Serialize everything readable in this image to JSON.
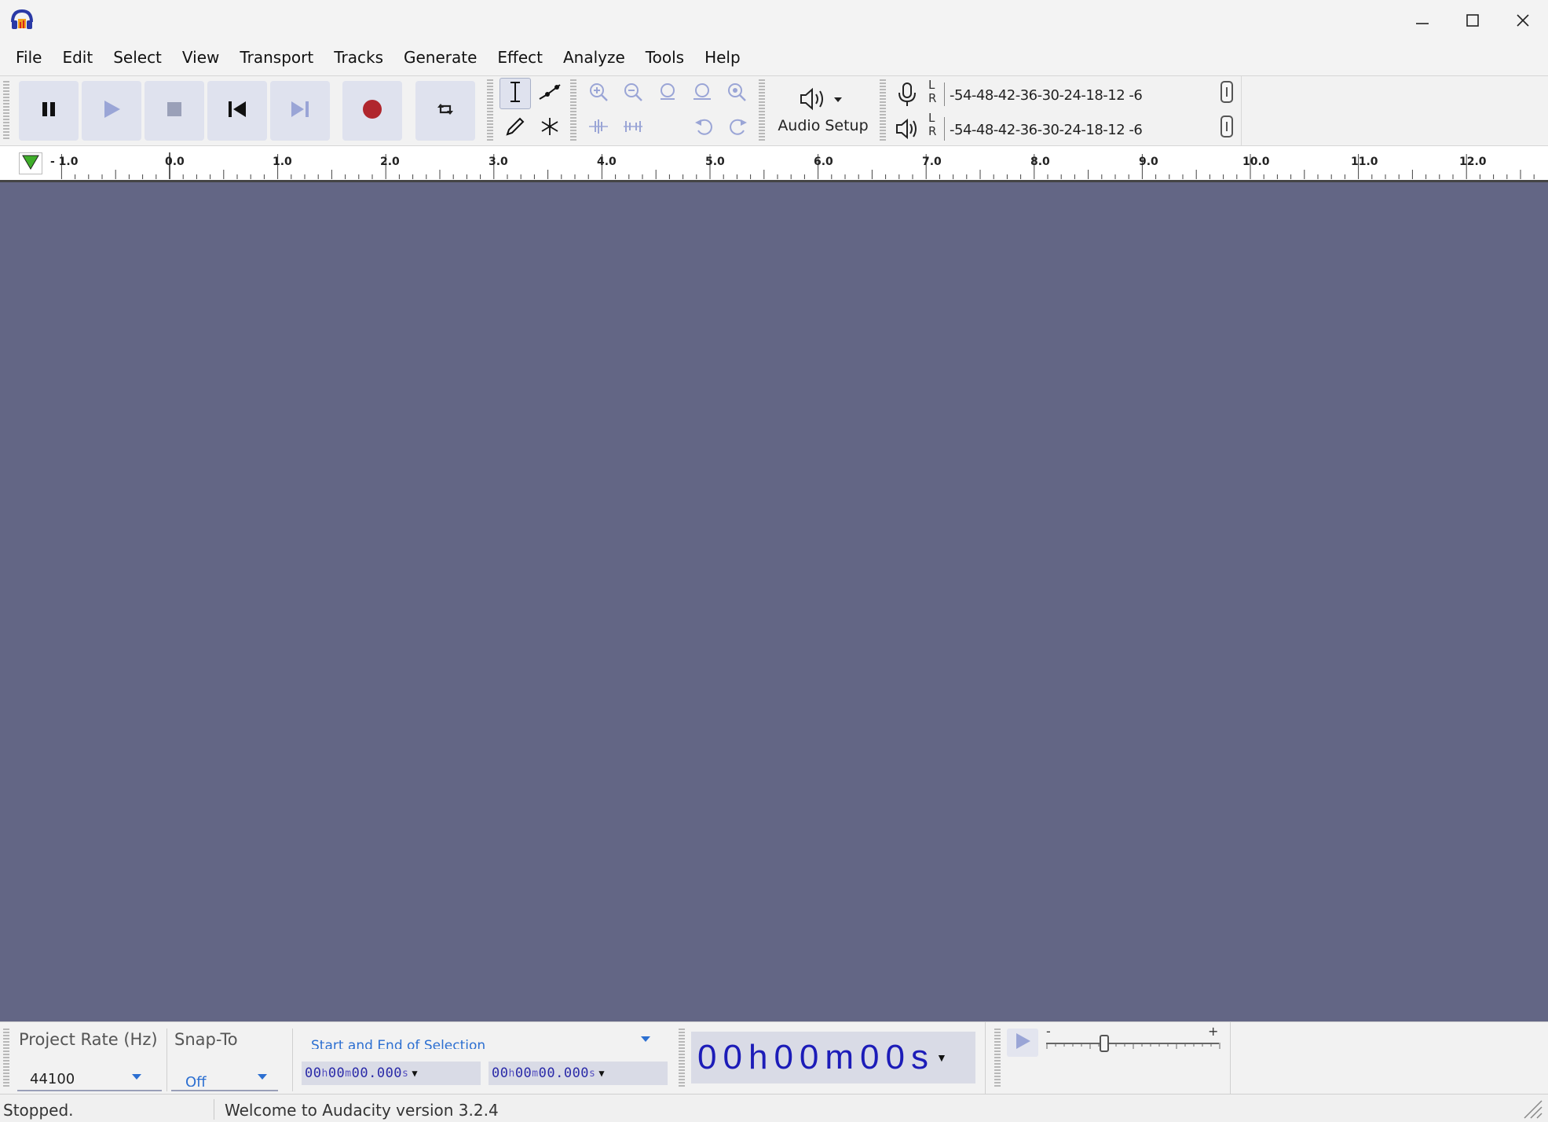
{
  "window": {
    "app_icon": "audacity-headphones-icon",
    "controls": [
      "minimize-icon",
      "maximize-icon",
      "close-icon"
    ]
  },
  "menu": [
    "File",
    "Edit",
    "Select",
    "View",
    "Transport",
    "Tracks",
    "Generate",
    "Effect",
    "Analyze",
    "Tools",
    "Help"
  ],
  "transport": {
    "buttons": [
      "pause-icon",
      "play-icon",
      "stop-icon",
      "skip-to-start-icon",
      "skip-to-end-icon",
      "record-icon",
      "loop-icon"
    ],
    "record_color": "#b0262d",
    "play_color": "#9aa5d6"
  },
  "tools": [
    "selection-tool-icon",
    "envelope-tool-icon",
    "draw-tool-icon",
    "multi-tool-icon"
  ],
  "edit": [
    "zoom-in-icon",
    "zoom-out-icon",
    "fit-selection-icon",
    "fit-project-icon",
    "zoom-toggle-icon",
    "trim-outside-icon",
    "silence-selection-icon",
    "undo-icon",
    "redo-icon"
  ],
  "audio_setup": {
    "label": "Audio Setup",
    "icon": "speaker-icon"
  },
  "meters": {
    "record": {
      "icon": "microphone-icon",
      "l": "L",
      "r": "R",
      "scale": "-54-48-42-36-30-24-18-12 -6"
    },
    "playback": {
      "icon": "speaker-icon",
      "l": "L",
      "r": "R",
      "scale": "-54-48-42-36-30-24-18-12 -6"
    }
  },
  "ruler": {
    "labels": [
      "- 1.0",
      "0.0",
      "1.0",
      "2.0",
      "3.0",
      "4.0",
      "5.0",
      "6.0",
      "7.0",
      "8.0",
      "9.0",
      "10.0",
      "11.0",
      "12.0"
    ],
    "marker_icon": "play-head-triangle-icon",
    "marker_color": "#3fae2a"
  },
  "track_area": {
    "background": "#636685"
  },
  "selection_toolbar": {
    "project_rate_label": "Project Rate (Hz)",
    "project_rate_value": "44100",
    "snap_to_label": "Snap-To",
    "snap_to_value": "Off",
    "selection_mode": "Start and End of Selection",
    "start_time": {
      "h": "00",
      "m": "00",
      "s": "00.000"
    },
    "end_time": {
      "h": "00",
      "m": "00",
      "s": "00.000"
    }
  },
  "time_display": {
    "h": "00",
    "m": "00",
    "s": "00",
    "hu": "h",
    "mu": "m",
    "su": "s"
  },
  "play_at_speed": {
    "icon": "play-at-speed-icon",
    "minus": "-",
    "plus": "+",
    "speed": 1.0
  },
  "status": {
    "left": "Stopped.",
    "message": "Welcome to Audacity version 3.2.4"
  }
}
